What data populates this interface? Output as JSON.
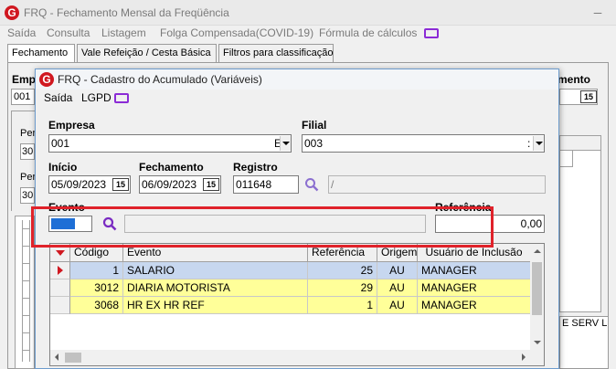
{
  "main_window": {
    "title": "FRQ - Fechamento Mensal da Freqüência",
    "logo_letter": "G",
    "menu": [
      "Saída",
      "Consulta",
      "Listagem",
      "Folga Compensada(COVID-19)",
      "Fórmula de cálculos"
    ],
    "tabs": [
      "Fechamento",
      "Vale Refeição / Cesta Básica",
      "Filtros para classificação"
    ],
    "bg": {
      "emp_label": "Emp",
      "emp_value": "001",
      "mento_label": "mento",
      "per1": "Per",
      "per1_val": "30",
      "per2": "Per",
      "per2_val": "30",
      "right_text": "E SERV L"
    }
  },
  "dialog": {
    "title": "FRQ - Cadastro do Acumulado (Variáveis)",
    "menu": [
      "Saída",
      "LGPD"
    ],
    "empresa": {
      "label": "Empresa",
      "value": "001",
      "partial": "E"
    },
    "filial": {
      "label": "Filial",
      "value": "003",
      "partial": ":"
    },
    "inicio": {
      "label": "Início",
      "value": "05/09/2023"
    },
    "fechamento": {
      "label": "Fechamento",
      "value": "06/09/2023"
    },
    "registro": {
      "label": "Registro",
      "value": "011648",
      "desc": "/"
    },
    "evento": {
      "label": "Evento"
    },
    "referencia": {
      "label": "Referência",
      "value": "0,00"
    },
    "calendar_label": "15"
  },
  "grid": {
    "columns": [
      "Código",
      "Evento",
      "Referência",
      "Origem",
      "Usuário de Inclusão"
    ],
    "rows": [
      {
        "codigo": "1",
        "evento": "SALARIO",
        "referencia": "25",
        "origem": "AU",
        "usuario": "MANAGER"
      },
      {
        "codigo": "3012",
        "evento": "DIARIA MOTORISTA",
        "referencia": "29",
        "origem": "AU",
        "usuario": "MANAGER"
      },
      {
        "codigo": "3068",
        "evento": "HR EX HR REF",
        "referencia": "1",
        "origem": "AU",
        "usuario": "MANAGER"
      }
    ]
  },
  "colors": {
    "selected_row": "#c7d7ef",
    "yellow_row": "#ffff99",
    "highlight_border": "#e0222a",
    "accent_icon": "#8b2bd6",
    "evento_swatch": "#1e6fd6"
  }
}
